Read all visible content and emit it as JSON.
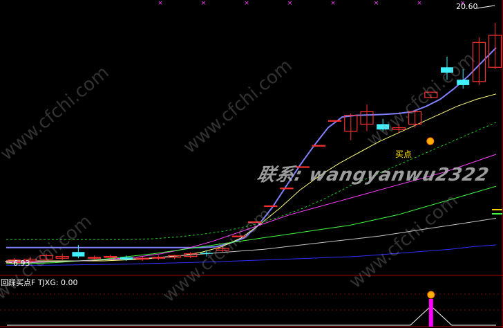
{
  "chart_data": {
    "type": "candlestick",
    "price_axis": {
      "high_label": "20.60",
      "low_label": "6.93",
      "ylim": [
        6.5,
        21.5
      ]
    },
    "candles": [
      {
        "o": 7.1,
        "h": 7.35,
        "c": 7.25,
        "l": 7.0
      },
      {
        "o": 7.2,
        "h": 7.45,
        "c": 7.3,
        "l": 7.1
      },
      {
        "o": 7.3,
        "h": 7.6,
        "c": 7.5,
        "l": 7.2
      },
      {
        "o": 7.35,
        "h": 7.6,
        "c": 7.45,
        "l": 7.25
      },
      {
        "o": 7.7,
        "h": 8.1,
        "c": 7.45,
        "l": 7.35
      },
      {
        "o": 7.35,
        "h": 7.5,
        "c": 7.4,
        "l": 7.25
      },
      {
        "o": 7.4,
        "h": 7.55,
        "c": 7.45,
        "l": 7.3
      },
      {
        "o": 7.4,
        "h": 7.5,
        "c": 7.28,
        "l": 7.2
      },
      {
        "o": 7.3,
        "h": 7.45,
        "c": 7.35,
        "l": 7.2
      },
      {
        "o": 7.35,
        "h": 7.5,
        "c": 7.4,
        "l": 7.25
      },
      {
        "o": 7.4,
        "h": 7.55,
        "c": 7.5,
        "l": 7.3
      },
      {
        "o": 7.45,
        "h": 7.7,
        "c": 7.6,
        "l": 7.35
      },
      {
        "o": 7.65,
        "h": 7.8,
        "c": 7.6,
        "l": 7.45
      },
      {
        "o": 7.8,
        "h": 8.0,
        "c": 7.9,
        "l": 7.7
      },
      {
        "o": 8.6,
        "h": 8.6,
        "c": 8.6,
        "l": 8.6
      },
      {
        "o": 9.4,
        "h": 9.4,
        "c": 9.4,
        "l": 9.4
      },
      {
        "o": 10.3,
        "h": 10.3,
        "c": 10.3,
        "l": 10.3
      },
      {
        "o": 11.3,
        "h": 11.3,
        "c": 11.3,
        "l": 11.3
      },
      {
        "o": 12.5,
        "h": 12.5,
        "c": 12.5,
        "l": 12.5
      },
      {
        "o": 13.7,
        "h": 13.7,
        "c": 13.7,
        "l": 13.7
      },
      {
        "o": 15.1,
        "h": 15.1,
        "c": 15.1,
        "l": 15.1
      },
      {
        "o": 14.5,
        "h": 15.5,
        "c": 15.4,
        "l": 14.0
      },
      {
        "o": 14.9,
        "h": 16.0,
        "c": 15.6,
        "l": 14.5
      },
      {
        "o": 14.9,
        "h": 15.2,
        "c": 14.6,
        "l": 14.5
      },
      {
        "o": 14.6,
        "h": 14.9,
        "c": 14.7,
        "l": 14.4
      },
      {
        "o": 14.9,
        "h": 15.7,
        "c": 15.6,
        "l": 14.7
      },
      {
        "o": 16.4,
        "h": 16.6,
        "c": 16.7,
        "l": 16.4
      },
      {
        "o": 18.1,
        "h": 18.7,
        "c": 17.8,
        "l": 17.4
      },
      {
        "o": 17.4,
        "h": 18.0,
        "c": 17.1,
        "l": 16.9
      },
      {
        "o": 17.3,
        "h": 19.8,
        "c": 19.5,
        "l": 17.1
      },
      {
        "o": 18.1,
        "h": 20.6,
        "c": 19.9,
        "l": 18.0
      }
    ],
    "moving_averages": [
      {
        "color": "#8080ff",
        "values": [
          7.95,
          7.95,
          7.95,
          7.95,
          7.95,
          7.95,
          7.95,
          7.95,
          7.95,
          7.95,
          7.95,
          7.95,
          7.95,
          7.95,
          7.95,
          8.0,
          8.2,
          8.5,
          9.2,
          10.2,
          11.4,
          12.6,
          13.7,
          14.7,
          15.3,
          15.4,
          15.42,
          15.45,
          15.5,
          15.6,
          15.9,
          16.3,
          16.9,
          17.6,
          18.4,
          19.2
        ]
      },
      {
        "color": "#ffff80",
        "values": [
          7.2,
          7.2,
          7.2,
          7.2,
          7.2,
          7.2,
          7.25,
          7.3,
          7.4,
          7.5,
          7.7,
          8.0,
          8.5,
          9.3,
          10.2,
          11.2,
          12.0,
          12.7,
          13.3,
          13.9,
          14.4,
          14.9,
          15.4,
          15.9,
          16.3,
          16.6
        ]
      },
      {
        "color": "#20d020",
        "dashed": true,
        "values": [
          8.4,
          8.4,
          8.4,
          8.4,
          8.4,
          8.4,
          8.45,
          8.55,
          8.7,
          8.9,
          9.2,
          9.6,
          10.1,
          10.7,
          11.4,
          12.0,
          12.6,
          13.2,
          13.8,
          14.4,
          15.0
        ]
      },
      {
        "color": "#ff40ff",
        "values": [
          7.15,
          7.15,
          7.15,
          7.2,
          7.3,
          7.4,
          7.6,
          7.9,
          8.3,
          8.8,
          9.3,
          9.8,
          10.2,
          10.6,
          11.0,
          11.4,
          11.8,
          12.2,
          12.7,
          13.2
        ]
      },
      {
        "color": "#40ff40",
        "values": [
          7.05,
          7.05,
          7.1,
          7.2,
          7.3,
          7.45,
          7.6,
          7.8,
          8.0,
          8.2,
          8.4,
          8.6,
          8.8,
          9.0,
          9.2,
          9.5,
          9.8,
          10.2,
          10.6,
          11.0,
          11.4
        ]
      },
      {
        "color": "#c8c8c8",
        "values": [
          7.1,
          7.1,
          7.15,
          7.2,
          7.25,
          7.3,
          7.35,
          7.45,
          7.55,
          7.65,
          7.75,
          7.85,
          8.0,
          8.15,
          8.3,
          8.45,
          8.6,
          8.8,
          9.0,
          9.2,
          9.4,
          9.6
        ]
      },
      {
        "color": "#3030ff",
        "values": [
          6.95,
          6.95,
          6.96,
          6.98,
          7.0,
          7.02,
          7.05,
          7.08,
          7.11,
          7.15,
          7.2,
          7.25,
          7.3,
          7.35,
          7.4,
          7.45,
          7.55,
          7.65,
          7.75,
          7.85,
          8.0,
          8.1
        ]
      }
    ],
    "buy_signal": {
      "label": "买点",
      "candle_index": 26
    },
    "indicator": {
      "title": "回踩买点F  TJXG: 0.00",
      "signal_candle_index": 26,
      "signal_color": "#ff00ff",
      "baseline_color": "#ffffff"
    },
    "watermark": "联系: wangyanwu2322",
    "site_watermark": "www.cfchi.com"
  }
}
